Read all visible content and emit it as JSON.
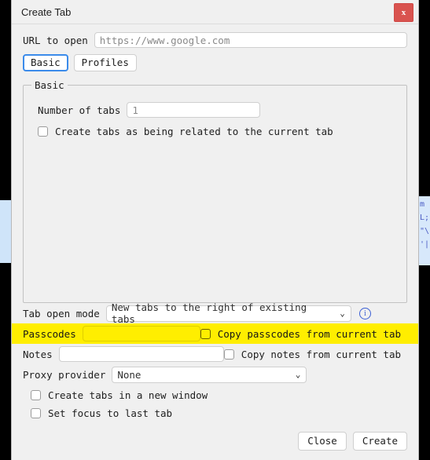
{
  "window": {
    "title": "Create Tab",
    "close_label": "x"
  },
  "url_row": {
    "label": "URL to open",
    "value": "https://www.google.com",
    "placeholder": "https://www.google.com"
  },
  "tabs": [
    {
      "label": "Basic",
      "active": true
    },
    {
      "label": "Profiles",
      "active": false
    }
  ],
  "basic_fieldset": {
    "legend": "Basic",
    "number_of_tabs": {
      "label": "Number of tabs",
      "value": "1"
    },
    "related_checkbox": {
      "label": "Create tabs as being related to the current tab",
      "checked": false
    }
  },
  "tab_open_mode": {
    "label": "Tab open mode",
    "value": "New tabs to the right of existing tabs",
    "options": [
      "New tabs to the right of existing tabs"
    ],
    "caret": "⌄",
    "info_icon_label": "i"
  },
  "passcodes": {
    "label": "Passcodes",
    "value": "",
    "highlighted": true,
    "highlight_color": "#ffee00",
    "copy_checkbox": {
      "label": "Copy passcodes from current tab",
      "checked": false
    }
  },
  "notes": {
    "label": "Notes",
    "value": "",
    "copy_checkbox": {
      "label": "Copy notes from current tab",
      "checked": false
    }
  },
  "proxy_provider": {
    "label": "Proxy provider",
    "value": "None",
    "options": [
      "None"
    ],
    "caret": "⌄"
  },
  "options": [
    {
      "label": "Create tabs in a new window",
      "checked": false
    },
    {
      "label": "Set focus to last tab",
      "checked": false
    }
  ],
  "footer": {
    "close_label": "Close",
    "create_label": "Create"
  },
  "backdrop": {
    "right_text": "m\nL;\n\"\\\n'|",
    "accent_blue": "#cfe4f9"
  }
}
